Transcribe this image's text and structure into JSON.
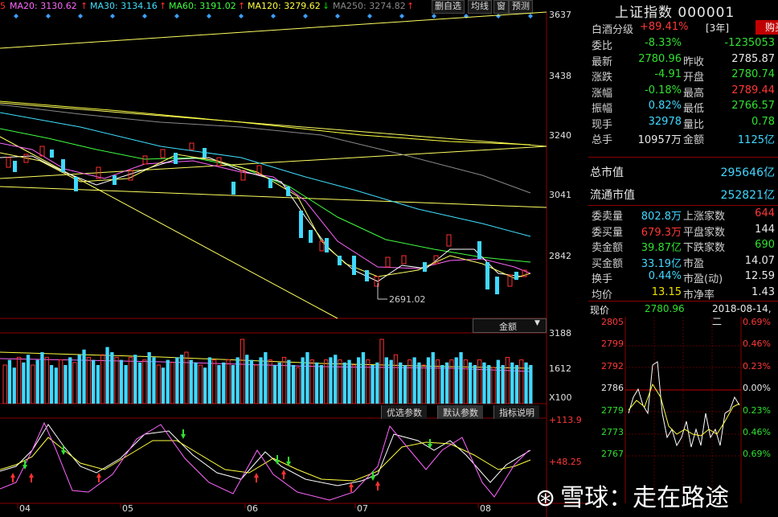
{
  "ma_bar": {
    "ma5": "5",
    "ma20": "MA20: 3130.62",
    "ma30": "MA30: 3134.16",
    "ma60": "MA60: 3191.02",
    "ma120": "MA120: 3279.62",
    "ma250": "MA250: 3274.82",
    "colors": {
      "ma20": "#ff66ff",
      "ma30": "#40e0ff",
      "ma60": "#40ff40",
      "ma120": "#ffff40",
      "ma250": "#888888"
    }
  },
  "top_buttons": {
    "delete": "删自选",
    "mean": "均线",
    "window": "窗",
    "forecast": "预测"
  },
  "price_axis": [
    "3637",
    "3438",
    "3240",
    "3041",
    "2842"
  ],
  "low_marker": "2691.02",
  "volume": {
    "selector": "金额",
    "axis_top": "3188",
    "axis_mid": "1612",
    "axis_unit": "X100"
  },
  "indicator_tabs": {
    "optimal": "优选参数",
    "default": "默认参数",
    "help": "指标说明"
  },
  "indicator_axis": {
    "top": "+113.9",
    "mid": "+48.25"
  },
  "x_labels": [
    "04",
    "05",
    "06",
    "07",
    "08"
  ],
  "panel": {
    "title": "上证指数 000001",
    "stock_line": {
      "label": "白酒分级",
      "value": "+89.41%",
      "tag": "[3年]",
      "buy": "购买"
    },
    "rows1": [
      {
        "l1": "委比",
        "v1": "-8.33%",
        "c1": "grn",
        "l2": "",
        "v2": "-1235053",
        "c2": "grn"
      },
      {
        "l1": "最新",
        "v1": "2780.96",
        "c1": "grn",
        "l2": "昨收",
        "v2": "2785.87",
        "c2": "wht"
      },
      {
        "l1": "涨跌",
        "v1": "-4.91",
        "c1": "grn",
        "l2": "开盘",
        "v2": "2780.74",
        "c2": "grn"
      },
      {
        "l1": "涨幅",
        "v1": "-0.18%",
        "c1": "grn",
        "l2": "最高",
        "v2": "2789.44",
        "c2": "red"
      },
      {
        "l1": "振幅",
        "v1": "0.82%",
        "c1": "cyn",
        "l2": "最低",
        "v2": "2766.57",
        "c2": "grn"
      },
      {
        "l1": "现手",
        "v1": "32978",
        "c1": "cyn",
        "l2": "量比",
        "v2": "0.78",
        "c2": "grn"
      },
      {
        "l1": "总手",
        "v1": "10957万",
        "c1": "wht",
        "l2": "金额",
        "v2": "1125亿",
        "c2": "cyn"
      }
    ],
    "mkt_cap": {
      "label": "总市值",
      "value": "295646亿"
    },
    "float_cap": {
      "label": "流通市值",
      "value": "252821亿"
    },
    "rows2": [
      {
        "l1": "委卖量",
        "v1": "802.8万",
        "c1": "cyn",
        "l2": "上涨家数",
        "v2": "644",
        "c2": "red"
      },
      {
        "l1": "委买量",
        "v1": "679.3万",
        "c1": "red",
        "l2": "平盘家数",
        "v2": "144",
        "c2": "wht"
      },
      {
        "l1": "卖金额",
        "v1": "39.87亿",
        "c1": "grn",
        "l2": "下跌家数",
        "v2": "690",
        "c2": "grn"
      },
      {
        "l1": "买金额",
        "v1": "33.19亿",
        "c1": "cyn",
        "l2": "市盈",
        "v2": "14.07",
        "c2": "wht"
      },
      {
        "l1": "换手",
        "v1": "0.44%",
        "c1": "cyn",
        "l2": "市盈(动)",
        "v2": "12.59",
        "c2": "wht"
      },
      {
        "l1": "均价",
        "v1": "13.15",
        "c1": "ylw",
        "l2": "市净率",
        "v2": "1.43",
        "c2": "wht"
      }
    ],
    "intraday": {
      "label": "现价",
      "price": "2780.96",
      "date": "2018-08-14,二",
      "left_axis": [
        "2805",
        "2799",
        "2792",
        "2786",
        "2779",
        "2773",
        "2767"
      ],
      "right_axis": [
        "0.69%",
        "0.46%",
        "0.23%",
        "0.00%",
        "0.23%",
        "0.46%",
        "0.69%"
      ]
    }
  },
  "watermark": "雪球：走在路途"
}
